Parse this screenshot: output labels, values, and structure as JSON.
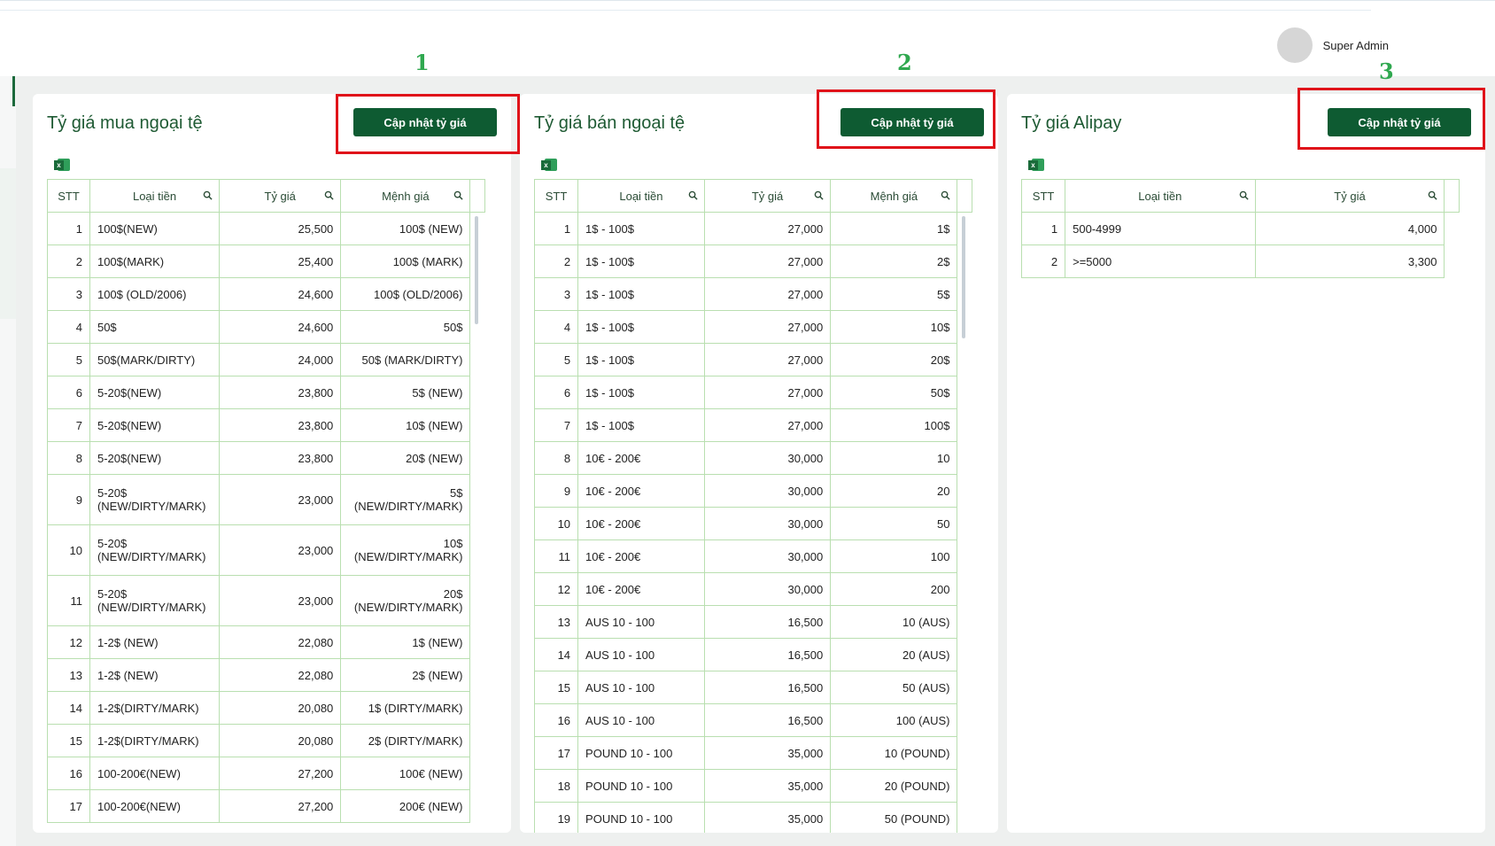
{
  "header": {
    "user_name": "Super Admin"
  },
  "annotations": [
    "1",
    "2",
    "3"
  ],
  "buy_panel": {
    "title": "Tỷ giá mua ngoại tệ",
    "button": "Cập nhật tỷ giá",
    "columns": [
      "STT",
      "Loại tiền",
      "Tỷ giá",
      "Mệnh giá"
    ],
    "rows": [
      {
        "stt": "1",
        "currency": "100$(NEW)",
        "rate": "25,500",
        "denom": "100$ (NEW)"
      },
      {
        "stt": "2",
        "currency": "100$(MARK)",
        "rate": "25,400",
        "denom": "100$ (MARK)"
      },
      {
        "stt": "3",
        "currency": "100$ (OLD/2006)",
        "rate": "24,600",
        "denom": "100$ (OLD/2006)"
      },
      {
        "stt": "4",
        "currency": "50$",
        "rate": "24,600",
        "denom": "50$"
      },
      {
        "stt": "5",
        "currency": "50$(MARK/DIRTY)",
        "rate": "24,000",
        "denom": "50$ (MARK/DIRTY)"
      },
      {
        "stt": "6",
        "currency": "5-20$(NEW)",
        "rate": "23,800",
        "denom": "5$ (NEW)"
      },
      {
        "stt": "7",
        "currency": "5-20$(NEW)",
        "rate": "23,800",
        "denom": "10$ (NEW)"
      },
      {
        "stt": "8",
        "currency": "5-20$(NEW)",
        "rate": "23,800",
        "denom": "20$ (NEW)"
      },
      {
        "stt": "9",
        "currency": "5-20$ (NEW/DIRTY/MARK)",
        "rate": "23,000",
        "denom": "5$ (NEW/DIRTY/MARK)"
      },
      {
        "stt": "10",
        "currency": "5-20$ (NEW/DIRTY/MARK)",
        "rate": "23,000",
        "denom": "10$ (NEW/DIRTY/MARK)"
      },
      {
        "stt": "11",
        "currency": "5-20$ (NEW/DIRTY/MARK)",
        "rate": "23,000",
        "denom": "20$ (NEW/DIRTY/MARK)"
      },
      {
        "stt": "12",
        "currency": "1-2$ (NEW)",
        "rate": "22,080",
        "denom": "1$ (NEW)"
      },
      {
        "stt": "13",
        "currency": "1-2$ (NEW)",
        "rate": "22,080",
        "denom": "2$ (NEW)"
      },
      {
        "stt": "14",
        "currency": "1-2$(DIRTY/MARK)",
        "rate": "20,080",
        "denom": "1$ (DIRTY/MARK)"
      },
      {
        "stt": "15",
        "currency": "1-2$(DIRTY/MARK)",
        "rate": "20,080",
        "denom": "2$ (DIRTY/MARK)"
      },
      {
        "stt": "16",
        "currency": "100-200€(NEW)",
        "rate": "27,200",
        "denom": "100€ (NEW)"
      },
      {
        "stt": "17",
        "currency": "100-200€(NEW)",
        "rate": "27,200",
        "denom": "200€ (NEW)"
      }
    ]
  },
  "sell_panel": {
    "title": "Tỷ giá bán ngoại tệ",
    "button": "Cập nhật tỷ giá",
    "columns": [
      "STT",
      "Loại tiền",
      "Tỷ giá",
      "Mệnh giá"
    ],
    "rows": [
      {
        "stt": "1",
        "currency": "1$ - 100$",
        "rate": "27,000",
        "denom": "1$"
      },
      {
        "stt": "2",
        "currency": "1$ - 100$",
        "rate": "27,000",
        "denom": "2$"
      },
      {
        "stt": "3",
        "currency": "1$ - 100$",
        "rate": "27,000",
        "denom": "5$"
      },
      {
        "stt": "4",
        "currency": "1$ - 100$",
        "rate": "27,000",
        "denom": "10$"
      },
      {
        "stt": "5",
        "currency": "1$ - 100$",
        "rate": "27,000",
        "denom": "20$"
      },
      {
        "stt": "6",
        "currency": "1$ - 100$",
        "rate": "27,000",
        "denom": "50$"
      },
      {
        "stt": "7",
        "currency": "1$ - 100$",
        "rate": "27,000",
        "denom": "100$"
      },
      {
        "stt": "8",
        "currency": "10€ - 200€",
        "rate": "30,000",
        "denom": "10"
      },
      {
        "stt": "9",
        "currency": "10€ - 200€",
        "rate": "30,000",
        "denom": "20"
      },
      {
        "stt": "10",
        "currency": "10€ - 200€",
        "rate": "30,000",
        "denom": "50"
      },
      {
        "stt": "11",
        "currency": "10€ - 200€",
        "rate": "30,000",
        "denom": "100"
      },
      {
        "stt": "12",
        "currency": "10€ - 200€",
        "rate": "30,000",
        "denom": "200"
      },
      {
        "stt": "13",
        "currency": "AUS 10 - 100",
        "rate": "16,500",
        "denom": "10 (AUS)"
      },
      {
        "stt": "14",
        "currency": "AUS 10 - 100",
        "rate": "16,500",
        "denom": "20 (AUS)"
      },
      {
        "stt": "15",
        "currency": "AUS 10 - 100",
        "rate": "16,500",
        "denom": "50 (AUS)"
      },
      {
        "stt": "16",
        "currency": "AUS 10 - 100",
        "rate": "16,500",
        "denom": "100 (AUS)"
      },
      {
        "stt": "17",
        "currency": "POUND 10 - 100",
        "rate": "35,000",
        "denom": "10 (POUND)"
      },
      {
        "stt": "18",
        "currency": "POUND 10 - 100",
        "rate": "35,000",
        "denom": "20 (POUND)"
      },
      {
        "stt": "19",
        "currency": "POUND 10 - 100",
        "rate": "35,000",
        "denom": "50 (POUND)"
      }
    ]
  },
  "alipay_panel": {
    "title": "Tỷ giá Alipay",
    "button": "Cập nhật tỷ giá",
    "columns": [
      "STT",
      "Loại tiền",
      "Tỷ giá"
    ],
    "rows": [
      {
        "stt": "1",
        "currency": "500-4999",
        "rate": "4,000"
      },
      {
        "stt": "2",
        "currency": ">=5000",
        "rate": "3,300"
      }
    ]
  },
  "icons": {
    "export": "excel-icon",
    "column_search": "search-icon"
  },
  "colors": {
    "accent": "#0e5b32",
    "title": "#1e5a33",
    "grid": "#b9dfb0",
    "highlight": "#e0131a",
    "annotation": "#2fa84f"
  }
}
